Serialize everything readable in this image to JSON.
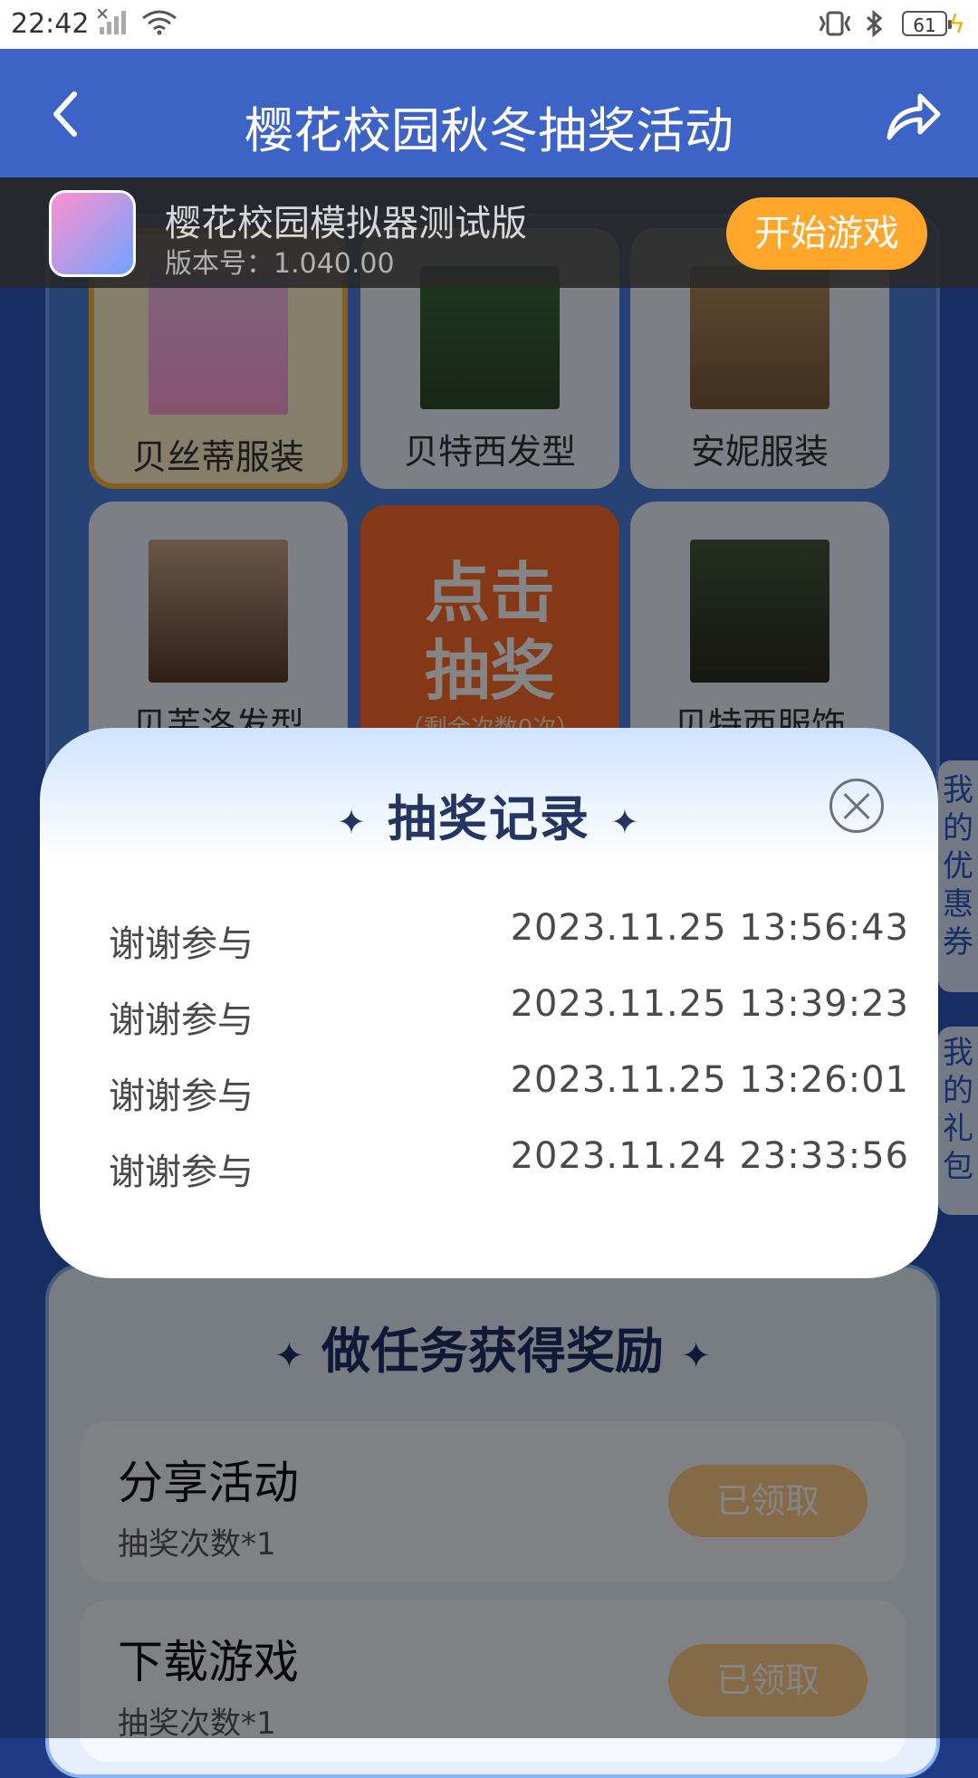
{
  "status_bar": {
    "time": "22:42",
    "battery": "61"
  },
  "header": {
    "title": "樱花校园秋冬抽奖活动"
  },
  "game_bar": {
    "app_name": "樱花校园模拟器测试版",
    "version": "版本号：1.040.00",
    "start_button": "开始游戏"
  },
  "prizes": [
    {
      "name": "贝丝蒂服装"
    },
    {
      "name": "贝特西发型"
    },
    {
      "name": "安妮服装"
    },
    {
      "name": "贝芙洛发型"
    },
    {
      "name": "贝特西服饰"
    }
  ],
  "draw_button": {
    "line1": "点击",
    "line2": "抽奖",
    "remaining": "（剩余次数0次）"
  },
  "side_tabs": {
    "coupons": "我的优惠券",
    "gifts": "我的礼包"
  },
  "modal": {
    "title": "抽奖记录",
    "records": [
      {
        "result": "谢谢参与",
        "time": "2023.11.25 13:56:43"
      },
      {
        "result": "谢谢参与",
        "time": "2023.11.25 13:39:23"
      },
      {
        "result": "谢谢参与",
        "time": "2023.11.25 13:26:01"
      },
      {
        "result": "谢谢参与",
        "time": "2023.11.24 23:33:56"
      }
    ]
  },
  "tasks": {
    "title": "做任务获得奖励",
    "items": [
      {
        "name": "分享活动",
        "reward": "抽奖次数*1",
        "status": "已领取"
      },
      {
        "name": "下载游戏",
        "reward": "抽奖次数*1",
        "status": "已领取"
      }
    ]
  },
  "colors": {
    "header": "#3d63c7",
    "accent_orange": "#ffa62b",
    "modal_title": "#243463"
  }
}
